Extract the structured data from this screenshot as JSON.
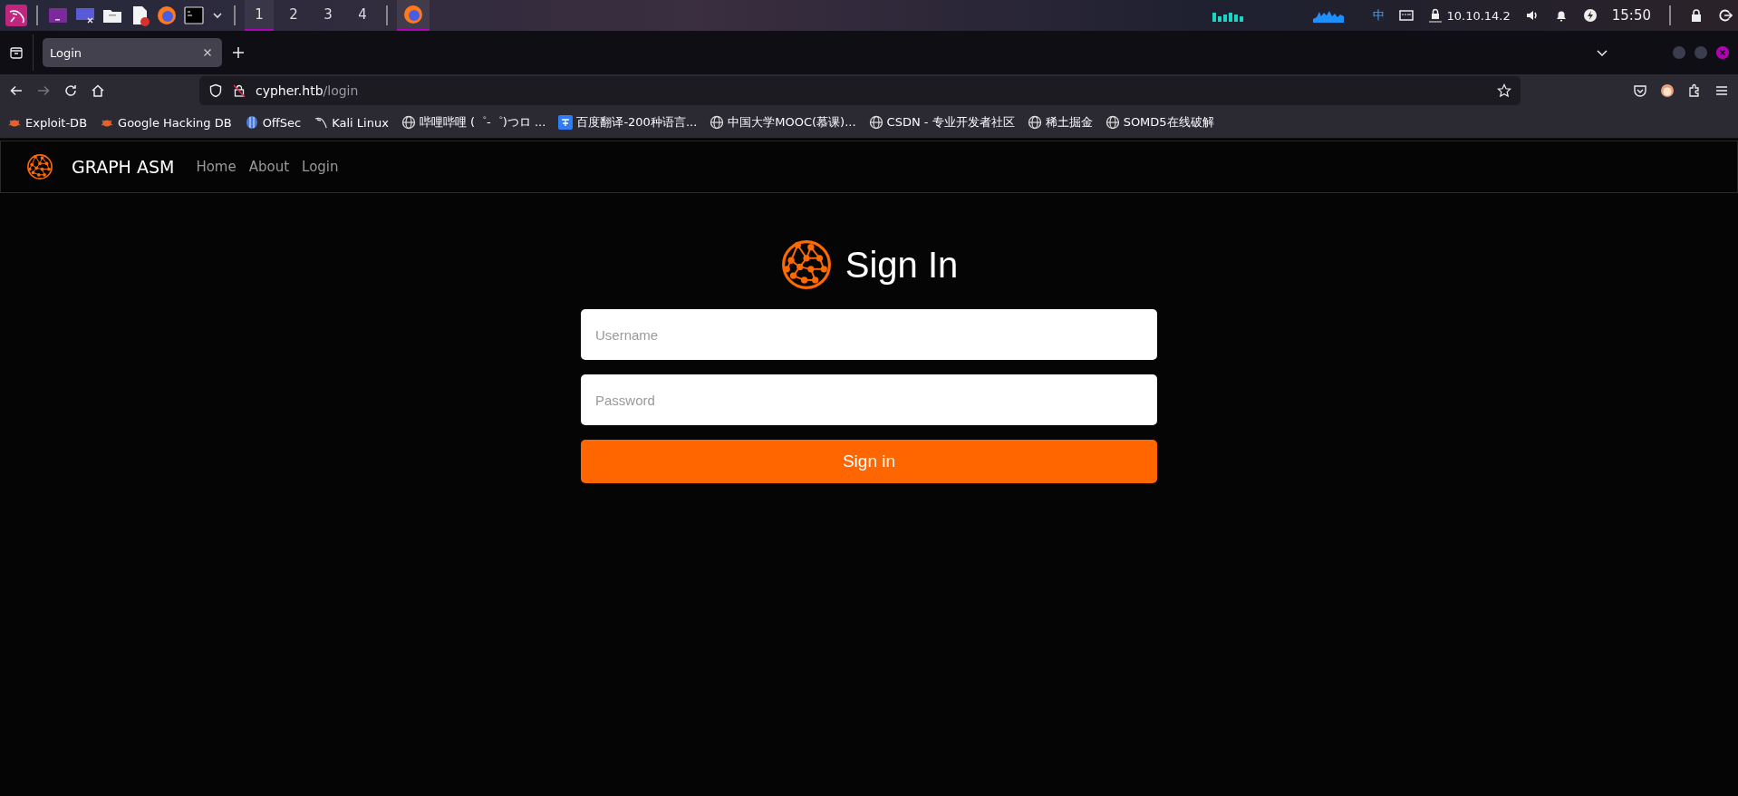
{
  "taskbar": {
    "workspaces": [
      {
        "label": "1",
        "selected": true
      },
      {
        "label": "2",
        "selected": false
      },
      {
        "label": "3",
        "selected": false
      },
      {
        "label": "4",
        "selected": false
      }
    ],
    "tray": {
      "input_method": "中",
      "ip": "10.10.14.2",
      "clock": "15:50"
    }
  },
  "browser": {
    "tabs": [
      {
        "title": "Login",
        "selected": true
      }
    ],
    "forward_disabled": true,
    "url": {
      "host": "cypher.htb",
      "path": "/login"
    },
    "bookmarks": [
      {
        "kind": "bug",
        "label": "Exploit-DB"
      },
      {
        "kind": "bug",
        "label": "Google Hacking DB"
      },
      {
        "kind": "offsec",
        "label": "OffSec"
      },
      {
        "kind": "kali",
        "label": "Kali Linux"
      },
      {
        "kind": "globe",
        "label": "哔哩哔哩 (゜-゜)つロ ..."
      },
      {
        "kind": "translate",
        "label": "百度翻译-200种语言..."
      },
      {
        "kind": "globe",
        "label": "中国大学MOOC(慕课)..."
      },
      {
        "kind": "globe",
        "label": "CSDN - 专业开发者社区"
      },
      {
        "kind": "globe",
        "label": "稀土掘金"
      },
      {
        "kind": "globe",
        "label": "SOMD5在线破解"
      }
    ]
  },
  "site": {
    "brand": "GRAPH ASM",
    "nav": [
      "Home",
      "About",
      "Login"
    ],
    "heading": "Sign In",
    "fields": [
      {
        "placeholder": "Username"
      },
      {
        "placeholder": "Password"
      }
    ],
    "submit": "Sign in"
  }
}
